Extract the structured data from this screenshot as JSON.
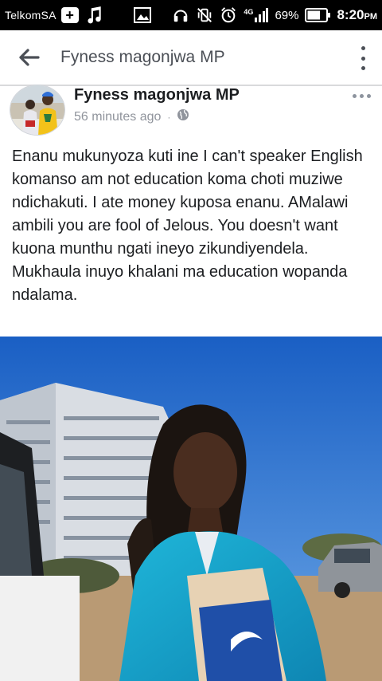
{
  "status_bar": {
    "carrier": "TelkomSA",
    "network": "4G",
    "battery_percent": "69%",
    "time": "8:20",
    "time_suffix": "PM",
    "icons": [
      "plus-badge-icon",
      "music-note-icon",
      "image-icon",
      "headset-icon",
      "vibrate-icon",
      "alarm-icon",
      "signal-icon",
      "battery-icon"
    ]
  },
  "app_bar": {
    "title": "Fyness magonjwa MP",
    "back_icon": "arrow-left-icon",
    "menu_icon": "more-vertical-icon"
  },
  "post": {
    "author": "Fyness magonjwa MP",
    "timestamp": "56 minutes ago",
    "separator": "·",
    "privacy_icon": "globe-icon",
    "options_icon": "more-horizontal-icon",
    "text": "Enanu mukunyoza kuti ine I can't speaker English komanso am not education koma choti muziwe ndichakuti. I ate money kuposa enanu. AMalawi ambili you are fool of Jelous. You doesn't want kuona munthu ngati ineyo zikundiyendela. Mukhaula inuyo khalani ma education wopanda ndalama."
  },
  "colors": {
    "status_bar_bg": "#000000",
    "title_text": "#4b4f56",
    "meta_text": "#90949c",
    "body_text": "#1c1e21"
  }
}
